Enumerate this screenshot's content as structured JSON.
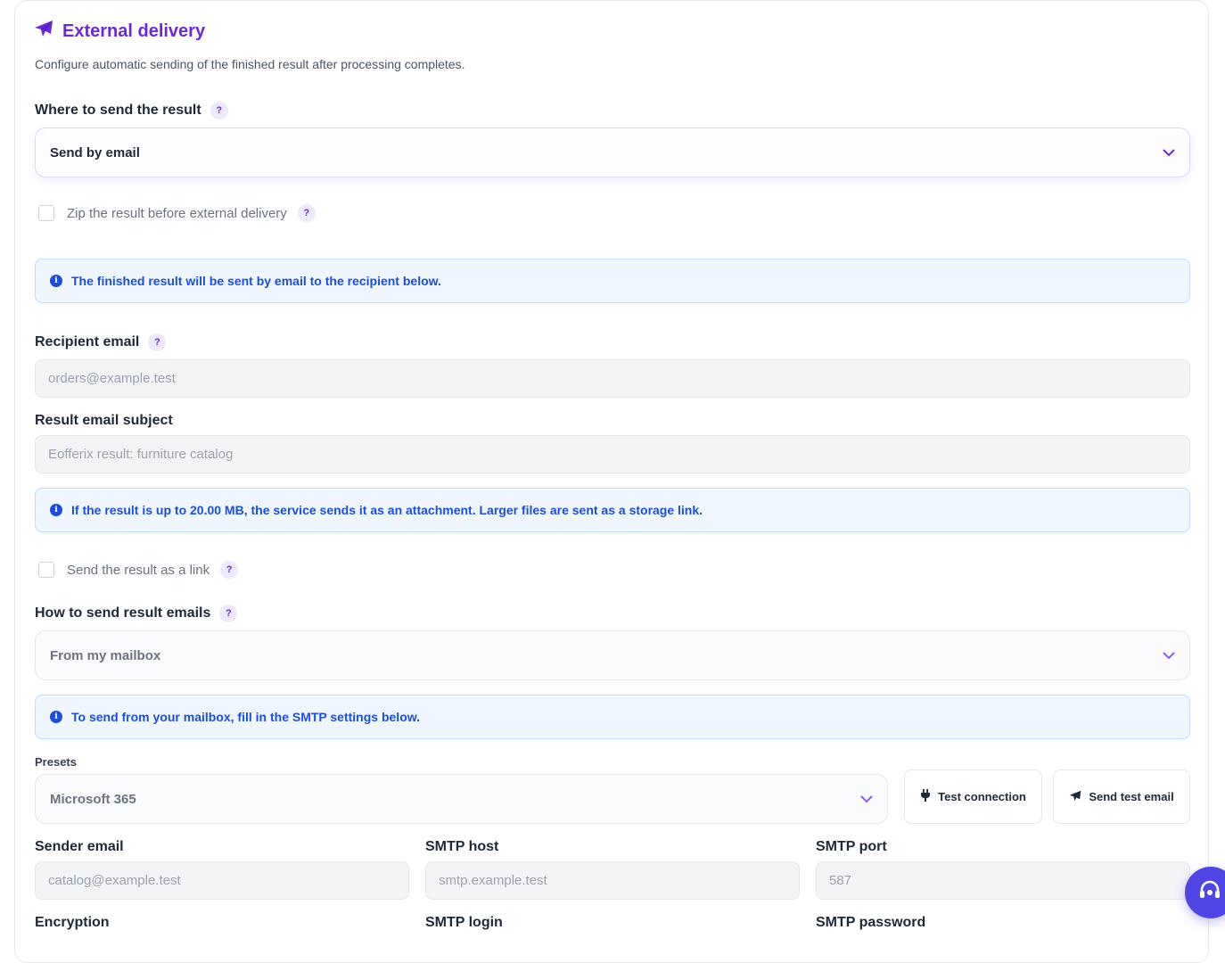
{
  "header": {
    "title": "External delivery",
    "subtitle": "Configure automatic sending of the finished result after processing completes."
  },
  "destination": {
    "label": "Where to send the result",
    "selected": "Send by email"
  },
  "zip_option": {
    "label": "Zip the result before external delivery",
    "checked": false
  },
  "info_email": "The finished result will be sent by email to the recipient below.",
  "recipient": {
    "label": "Recipient email",
    "value": "orders@example.test"
  },
  "subject": {
    "label": "Result email subject",
    "value": "Eofferix result: furniture catalog"
  },
  "info_attachment": "If the result is up to 20.00 MB, the service sends it as an attachment. Larger files are sent as a storage link.",
  "link_option": {
    "label": "Send the result as a link",
    "checked": false
  },
  "send_method": {
    "label": "How to send result emails",
    "selected": "From my mailbox"
  },
  "info_smtp": "To send from your mailbox, fill in the SMTP settings below.",
  "presets": {
    "label": "Presets",
    "selected": "Microsoft 365",
    "test_connection": "Test connection",
    "send_test_email": "Send test email"
  },
  "smtp": {
    "sender_email": {
      "label": "Sender email",
      "value": "catalog@example.test"
    },
    "host": {
      "label": "SMTP host",
      "value": "smtp.example.test"
    },
    "port": {
      "label": "SMTP port",
      "value": "587"
    },
    "encryption": {
      "label": "Encryption"
    },
    "login": {
      "label": "SMTP login"
    },
    "password": {
      "label": "SMTP password"
    }
  },
  "colors": {
    "accent": "#6d28d9",
    "info": "#1d4ed8",
    "support": "#4f46e5"
  },
  "icons": {
    "title": "paper-plane-icon",
    "help": "question-mark-icon",
    "select": "chevron-down-icon",
    "info": "info-icon",
    "test_connection": "plug-icon",
    "send_test_email": "paper-plane-icon",
    "support": "headset-icon"
  }
}
